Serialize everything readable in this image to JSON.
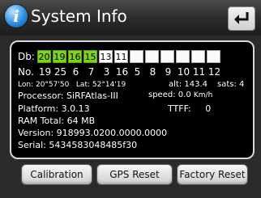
{
  "header": {
    "title": "System Info",
    "info_glyph": "i"
  },
  "satellites": {
    "db_label": "Db:",
    "db_values": [
      "20",
      "19",
      "16",
      "15",
      "13",
      "11",
      "",
      "",
      "",
      "",
      "",
      ""
    ],
    "no_label": "No.",
    "numbers": [
      "19",
      "25",
      "6",
      "7",
      "3",
      "16",
      "5",
      "8",
      "9",
      "10",
      "11",
      "12"
    ]
  },
  "gps": {
    "lon_label": "Lon:",
    "lon_value": "20°57'50",
    "lat_label": "Lat:",
    "lat_value": "52°14'19",
    "alt_label": "alt:",
    "alt_value": "143.4",
    "sats_label": "sats:",
    "sats_value": "4",
    "speed_label": "speed:",
    "speed_value": "0.0",
    "speed_unit": "Km/h",
    "ttff_label": "TTFF:",
    "ttff_value": "0"
  },
  "system": {
    "processor": "Processor: SiRFAtlas-III",
    "platform": "Platform: 3.0.13",
    "ram": "RAM Total: 64 MB",
    "version": "Version: 918993.0200.0000.0000",
    "serial": "Serial: 5434583048485f30"
  },
  "buttons": {
    "calibration": "Calibration",
    "gps_reset": "GPS Reset",
    "factory_reset": "Factory Reset"
  },
  "colors": {
    "good_signal": "#7ed321",
    "background": "#2b2b2b",
    "panel": "#000000"
  }
}
